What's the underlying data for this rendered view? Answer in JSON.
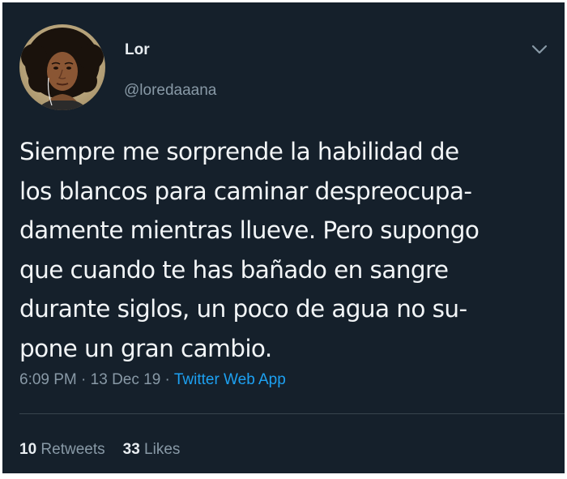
{
  "user": {
    "display_name": "Lor",
    "handle": "@loredaaana",
    "avatar_icon": "avatar-photo"
  },
  "menu": {
    "icon": "chevron-down-icon"
  },
  "tweet": {
    "lines": [
      "Siempre me sorprende la habilidad de",
      "los blancos para caminar despreocupa-",
      "damente mientras llueve. Pero supongo",
      "que cuando te has bañado en sangre",
      "durante siglos, un poco de agua no su-",
      "pone un gran cambio."
    ]
  },
  "meta": {
    "time": "6:09 PM",
    "sep1": " · ",
    "date": "13 Dec 19",
    "sep2": " · ",
    "source": "Twitter Web App"
  },
  "stats": {
    "retweets_count": "10",
    "retweets_label": "Retweets",
    "likes_count": "33",
    "likes_label": "Likes"
  },
  "colors": {
    "background": "#15202b",
    "text": "#f2f5f7",
    "muted": "#8899a6",
    "link": "#1da1f2",
    "divider": "#38444d"
  }
}
